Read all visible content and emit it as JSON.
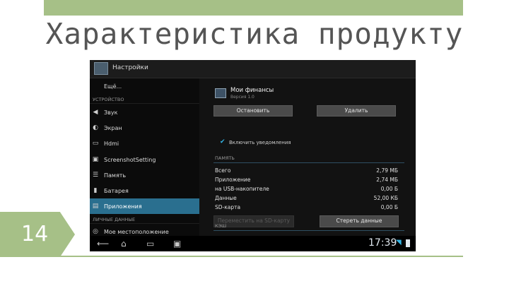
{
  "slide": {
    "title": "Характеристика продукту",
    "number": "14",
    "accent_color": "#a6c087"
  },
  "actionbar": {
    "title": "Настройки",
    "icon": "settings-app-icon"
  },
  "sidebar": {
    "more_label": "Ещё...",
    "section_device": "УСТРОЙСТВО",
    "items": [
      {
        "label": "Звук",
        "icon": "speaker-icon"
      },
      {
        "label": "Экран",
        "icon": "brightness-icon"
      },
      {
        "label": "Hdmi",
        "icon": "hdmi-icon"
      },
      {
        "label": "ScreenshotSetting",
        "icon": "screenshot-icon"
      },
      {
        "label": "Память",
        "icon": "storage-icon"
      },
      {
        "label": "Батарея",
        "icon": "battery-icon"
      },
      {
        "label": "Приложения",
        "icon": "apps-icon",
        "active": true
      }
    ],
    "section_personal": "ЛИЧНЫЕ ДАННЫЕ",
    "location_label": "Мое местоположение",
    "active_color": "#2a6f8f"
  },
  "app_detail": {
    "app_name": "Мои финансы",
    "version": "Версия 1.0",
    "stop_button": "Остановить",
    "remove_button": "Удалить",
    "notifications_label": "Включить уведомления",
    "memory_header": "ПАМЯТЬ",
    "stats": [
      {
        "label": "Всего",
        "value": "2,79 МБ"
      },
      {
        "label": "Приложение",
        "value": "2,74 МБ"
      },
      {
        "label": "на USB-накопителе",
        "value": "0,00 Б"
      },
      {
        "label": "Данные",
        "value": "52,00 КБ"
      },
      {
        "label": "SD-карта",
        "value": "0,00 Б"
      }
    ],
    "move_button": "Переместить на SD-карту",
    "clear_button": "Стереть данные",
    "cache_header": "КЭШ"
  },
  "statusbar": {
    "time": "17:39",
    "accent_color": "#33b5e5"
  }
}
